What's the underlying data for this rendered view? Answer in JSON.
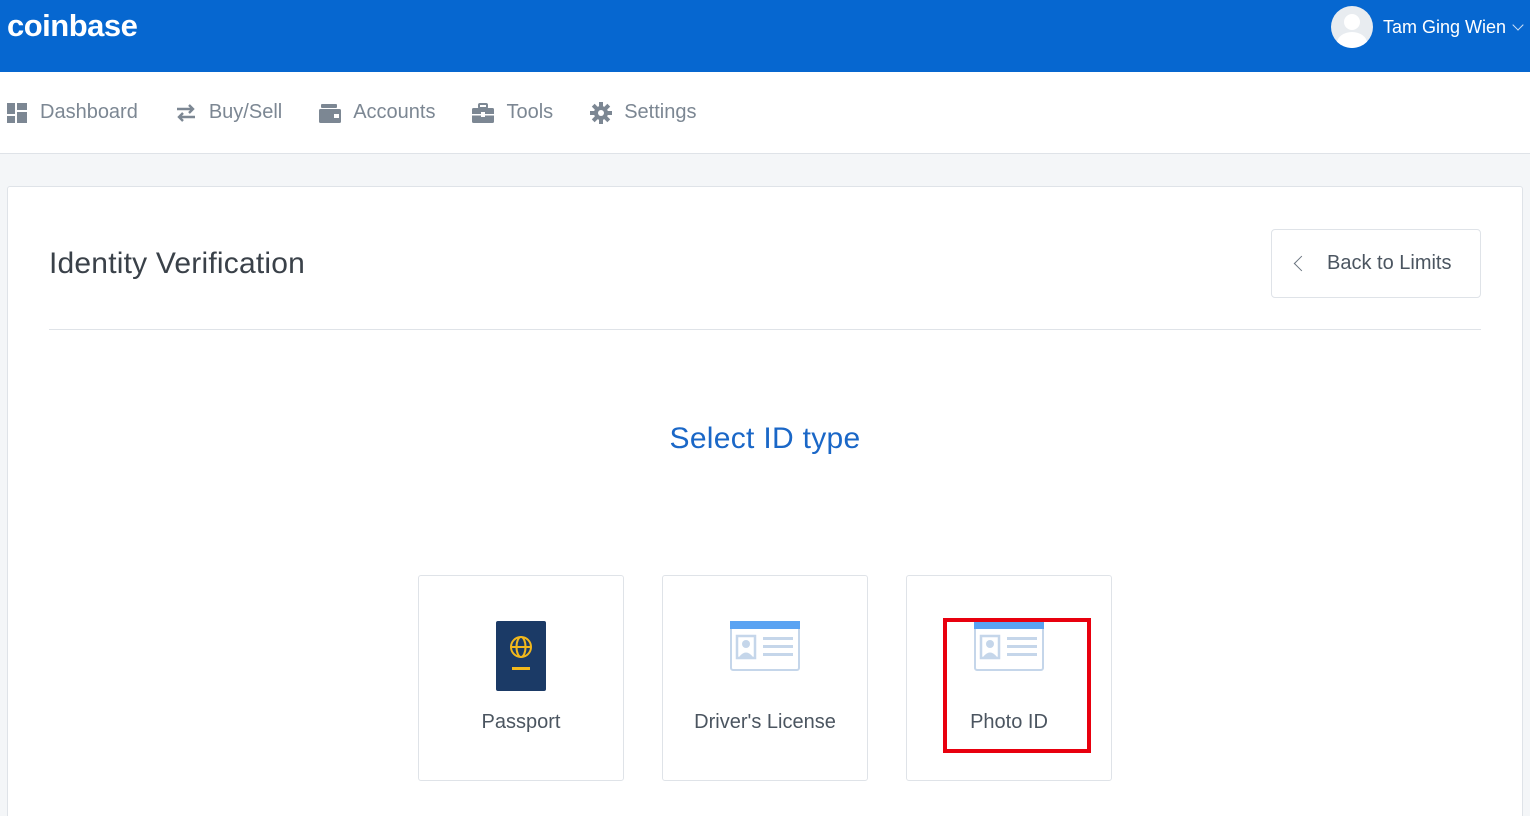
{
  "header": {
    "logo": "coinbase",
    "user_name": "Tam Ging Wien"
  },
  "nav": {
    "items": [
      {
        "label": "Dashboard",
        "icon": "dashboard-grid-icon"
      },
      {
        "label": "Buy/Sell",
        "icon": "swap-arrows-icon"
      },
      {
        "label": "Accounts",
        "icon": "wallet-icon"
      },
      {
        "label": "Tools",
        "icon": "toolbox-icon"
      },
      {
        "label": "Settings",
        "icon": "gear-icon"
      }
    ]
  },
  "page": {
    "title": "Identity Verification",
    "back_label": "Back to Limits",
    "section_title": "Select ID type"
  },
  "id_types": [
    {
      "label": "Passport",
      "icon": "passport-icon"
    },
    {
      "label": "Driver's License",
      "icon": "id-card-icon"
    },
    {
      "label": "Photo ID",
      "icon": "id-card-icon",
      "highlighted": true
    }
  ],
  "colors": {
    "brand_blue": "#0667d0",
    "title_blue": "#1a67c7",
    "highlight_red": "#e8000e",
    "passport_navy": "#1b3a66",
    "passport_gold": "#f2b81c"
  }
}
